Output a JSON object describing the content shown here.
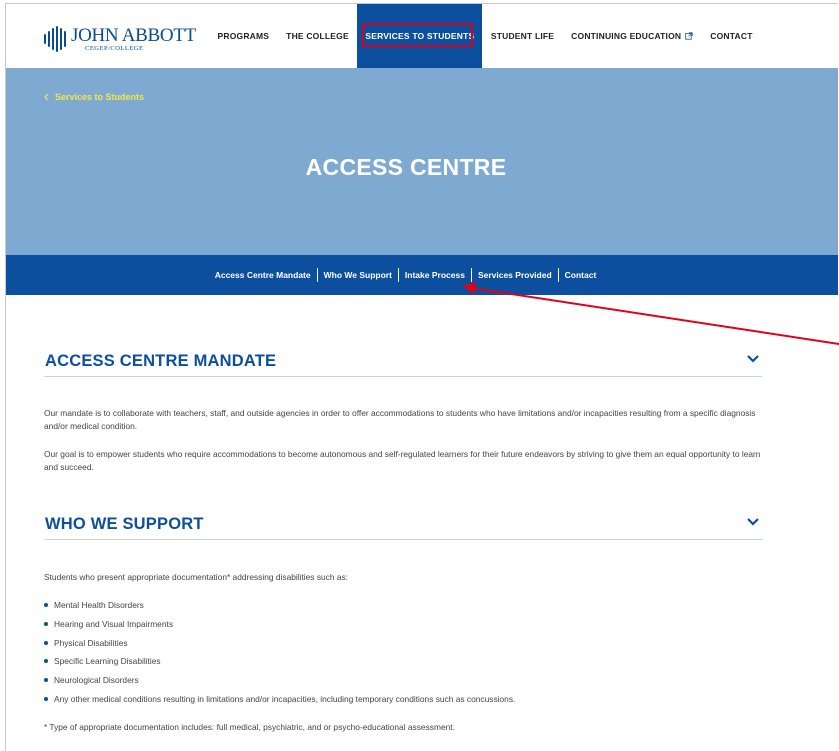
{
  "header": {
    "logo_name": "JOHN ABBOTT",
    "logo_sub": "CEGEP/COLLEGE",
    "nav": [
      {
        "label": "PROGRAMS"
      },
      {
        "label": "THE COLLEGE"
      },
      {
        "label": "SERVICES TO STUDENTS"
      },
      {
        "label": "STUDENT LIFE"
      },
      {
        "label": "CONTINUING EDUCATION"
      },
      {
        "label": "CONTACT"
      }
    ]
  },
  "hero": {
    "breadcrumb": "Services to Students",
    "title": "ACCESS CENTRE"
  },
  "subnav": {
    "items": [
      {
        "label": "Access Centre Mandate"
      },
      {
        "label": "Who We Support"
      },
      {
        "label": "Intake Process"
      },
      {
        "label": "Services Provided"
      },
      {
        "label": "Contact"
      }
    ]
  },
  "sections": {
    "mandate": {
      "title": "ACCESS CENTRE MANDATE",
      "p1": "Our mandate is to collaborate with teachers, staff, and outside agencies in order to offer accommodations to students who have limitations and/or incapacities resulting from a specific diagnosis and/or medical condition.",
      "p2": "Our goal is to empower students who require accommodations to become autonomous and self-regulated learners for their future endeavors by striving to give them an equal opportunity to learn and succeed."
    },
    "support": {
      "title": "WHO WE SUPPORT",
      "intro": "Students who present appropriate documentation* addressing disabilities such as:",
      "items": [
        "Mental Health Disorders",
        "Hearing and Visual Impairments",
        "Physical Disabilities",
        "Specific Learning Disabilities",
        "Neurological Disorders",
        "Any other medical conditions resulting in limitations and/or incapacities, including temporary conditions such as concussions."
      ],
      "footnote": "* Type of appropriate documentation includes: full medical, psychiatric, and or psycho-educational assessment."
    }
  },
  "colors": {
    "brand_blue": "#0b4f9e",
    "hero_blue": "#7ea9d1",
    "breadcrumb_yellow": "#f3e64a",
    "annotation_red": "#e0001b"
  },
  "icons": {
    "logo": "john-abbott-logo-mark",
    "external": "external-link-icon",
    "chevron": "chevron-down-icon",
    "back": "chevron-left-icon"
  }
}
